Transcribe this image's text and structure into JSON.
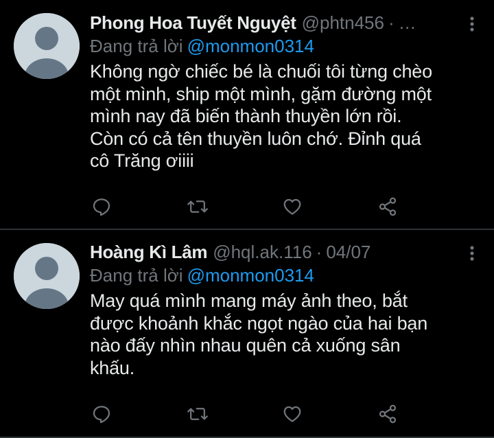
{
  "theme": {
    "background": "#000000",
    "text_primary": "#e7e9ea",
    "text_secondary": "#71767b",
    "accent": "#1d9bf0",
    "divider": "#2f3336",
    "avatar_bg": "#ccd6dd",
    "avatar_fg": "#657786"
  },
  "tweets": [
    {
      "display_name": "Phong Hoa Tuyết Nguyệt",
      "handle": "@phtn456",
      "separator": "·",
      "date": "…",
      "reply_prefix": "Đang trả lời",
      "reply_to": "@monmon0314",
      "body_lines": [
        "Không ngờ chiếc bé là chuối tôi từng chèo",
        "một mình, ship một mình, gặm đường một",
        "mình nay đã biến thành thuyền lớn rồi.",
        "Còn có cả tên thuyền luôn chớ. Đỉnh quá",
        "cô Trăng ơiiii"
      ],
      "actions": [
        "reply-icon",
        "retweet-icon",
        "like-icon",
        "share-icon"
      ]
    },
    {
      "display_name": "Hoàng Kì Lâm",
      "handle": "@hql.ak.116",
      "separator": "·",
      "date": "04/07",
      "reply_prefix": "Đang trả lời",
      "reply_to": "@monmon0314",
      "body_lines": [
        "May quá mình mang máy ảnh theo, bắt",
        "được khoảnh khắc ngọt ngào của hai bạn",
        "nào đấy nhìn nhau quên cả xuống sân",
        "khấu."
      ],
      "actions": [
        "reply-icon",
        "retweet-icon",
        "like-icon",
        "share-icon"
      ]
    }
  ]
}
